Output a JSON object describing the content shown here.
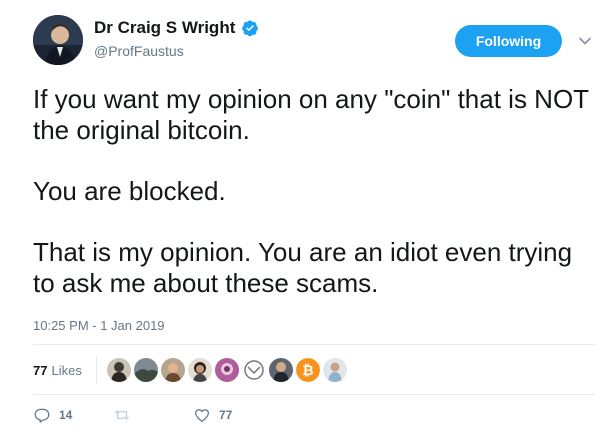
{
  "author": {
    "display_name": "Dr Craig S Wright",
    "handle": "@ProfFaustus",
    "verified": true,
    "avatar_icon": "profile-photo"
  },
  "follow_button": {
    "label": "Following",
    "color": "#1da1f2"
  },
  "menu": {
    "icon": "chevron-down-icon"
  },
  "tweet": {
    "paragraphs": [
      "If you want my opinion on any \"coin\" that is NOT the original bitcoin.",
      "You are blocked.",
      "That is my opinion. You are an idiot even trying to ask me about these scams."
    ],
    "timestamp": "10:25 PM - 1 Jan 2019"
  },
  "likes": {
    "count": "77",
    "label": "Likes",
    "liker_avatars": [
      "liker-avatar-1",
      "liker-avatar-2",
      "liker-avatar-3",
      "liker-avatar-4",
      "liker-avatar-5",
      "liker-avatar-6",
      "liker-avatar-7",
      "liker-avatar-8",
      "liker-avatar-9"
    ]
  },
  "actions": {
    "reply_count": "14",
    "retweet_count": "",
    "like_count": "77"
  },
  "colors": {
    "secondary_text": "#657786",
    "divider": "#e6ecf0",
    "bitcoin_orange": "#f7931a"
  }
}
